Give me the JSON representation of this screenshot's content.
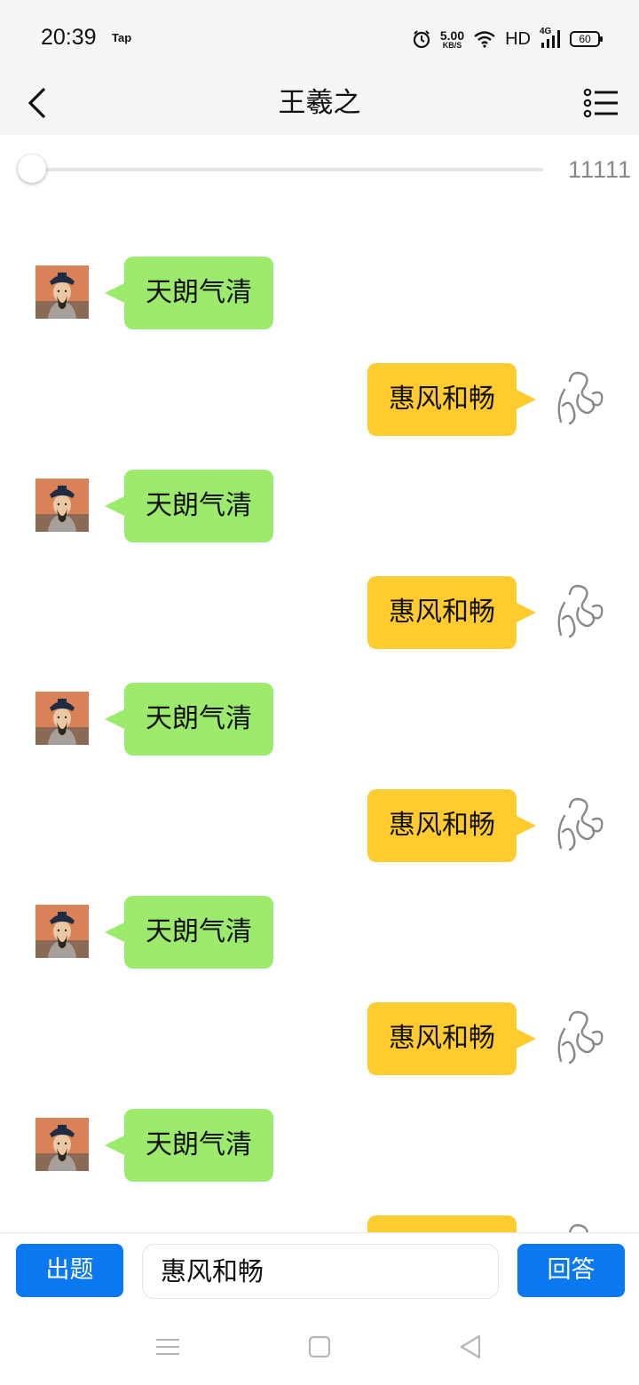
{
  "status_bar": {
    "time": "20:39",
    "app_label": "Tap",
    "net_speed_value": "5.00",
    "net_speed_unit": "KB/S",
    "network_label": "HD",
    "network_type": "4G",
    "battery": "60",
    "icons": [
      "alarm-icon",
      "wifi-icon",
      "signal-icon",
      "battery-icon"
    ]
  },
  "header": {
    "title": "王羲之",
    "back_icon": "chevron-left-icon",
    "menu_icon": "list-menu-icon"
  },
  "slider": {
    "value_text": "11111",
    "position_fraction": 0.0
  },
  "messages": [
    {
      "side": "left",
      "text": "天朗气清",
      "avatar": "wang-xizhi-portrait"
    },
    {
      "side": "right",
      "text": "惠风和畅",
      "avatar": "calligraphy-avatar"
    },
    {
      "side": "left",
      "text": "天朗气清",
      "avatar": "wang-xizhi-portrait"
    },
    {
      "side": "right",
      "text": "惠风和畅",
      "avatar": "calligraphy-avatar"
    },
    {
      "side": "left",
      "text": "天朗气清",
      "avatar": "wang-xizhi-portrait"
    },
    {
      "side": "right",
      "text": "惠风和畅",
      "avatar": "calligraphy-avatar"
    },
    {
      "side": "left",
      "text": "天朗气清",
      "avatar": "wang-xizhi-portrait"
    },
    {
      "side": "right",
      "text": "惠风和畅",
      "avatar": "calligraphy-avatar"
    },
    {
      "side": "left",
      "text": "天朗气清",
      "avatar": "wang-xizhi-portrait"
    },
    {
      "side": "right",
      "text": "",
      "avatar": "calligraphy-avatar"
    }
  ],
  "input_bar": {
    "ask_label": "出题",
    "answer_value": "惠风和畅",
    "answer_label": "回答"
  },
  "colors": {
    "left_bubble": "#9bea6b",
    "right_bubble": "#ffcb2f",
    "button_blue": "#0a78f0",
    "header_bg": "#f5f5f5"
  },
  "system_nav": [
    "menu-icon",
    "home-square-icon",
    "back-triangle-icon"
  ]
}
